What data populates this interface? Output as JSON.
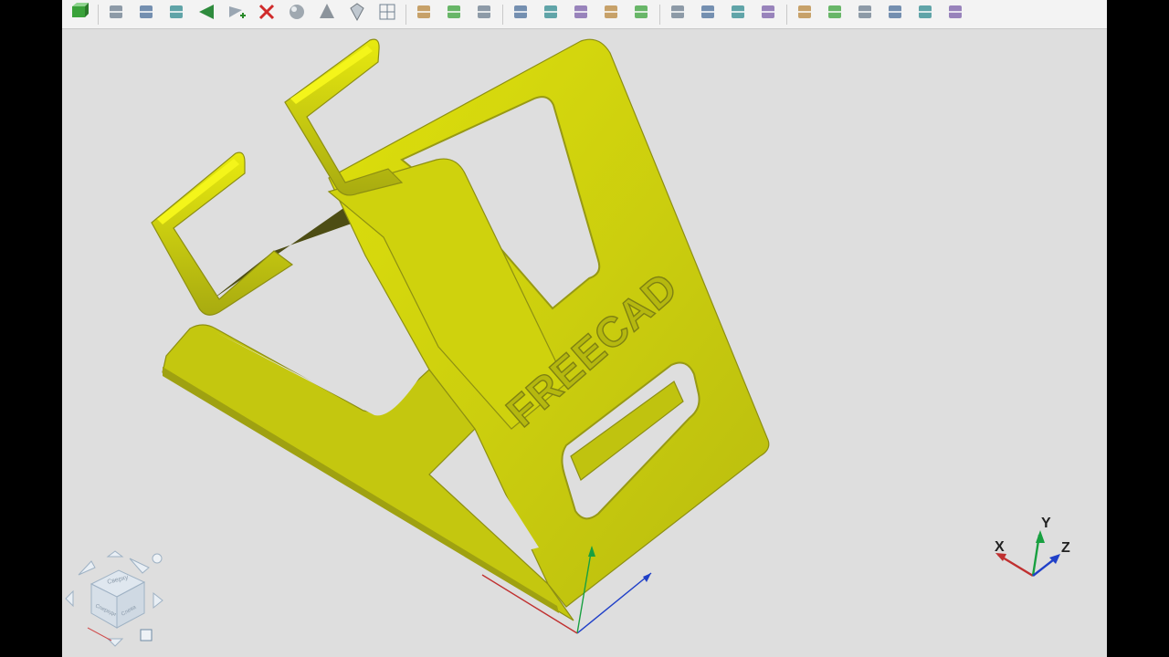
{
  "toolbar": {
    "groups": [
      [
        "box-icon"
      ],
      [
        "cut-icon",
        "rotate-icon",
        "section-icon",
        "revolve-icon",
        "add-vertex-icon",
        "delete-vertex-icon",
        "sphere-icon",
        "cone-icon",
        "gem-icon",
        "grid-icon"
      ],
      [
        "sewing-icon",
        "fuse-icon",
        "common-icon"
      ],
      [
        "scissors-icon",
        "offset-icon",
        "draft-icon",
        "loft-icon",
        "sweep-icon"
      ],
      [
        "chamfer-icon",
        "shape-icon",
        "shell-icon",
        "split-icon"
      ],
      [
        "measure-icon",
        "view-fit-icon",
        "view-select-icon",
        "pick-icon",
        "inspect-icon",
        "settings-icon"
      ]
    ]
  },
  "model": {
    "engraved_text": "FREECAD",
    "body_color": "#c8cc0e",
    "shadow_color": "#4a4a12"
  },
  "axis_triad": {
    "x": "X",
    "y": "Y",
    "z": "Z"
  },
  "nav_cube": {
    "faces": [
      "Сверху",
      "Спереди",
      "Слева"
    ]
  },
  "colors": {
    "x_axis": "#c03030",
    "y_axis": "#18a040",
    "z_axis": "#2040c8"
  }
}
